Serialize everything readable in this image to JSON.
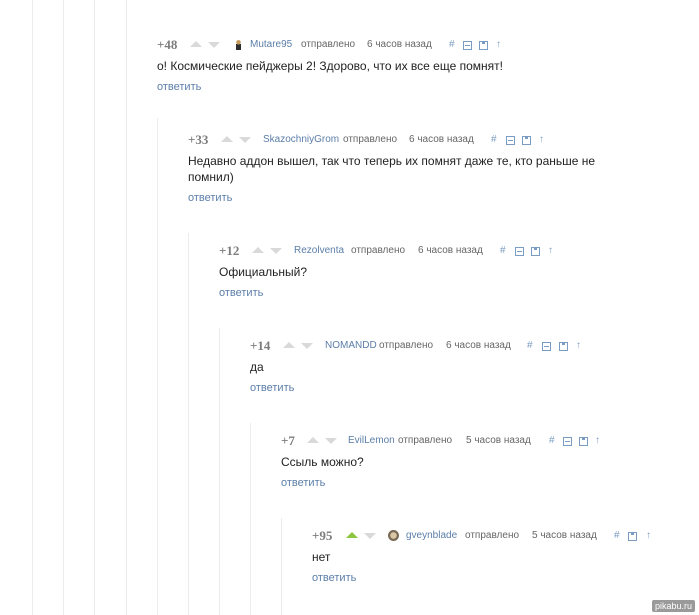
{
  "comments": [
    {
      "score": "+48",
      "user": "Mutare95",
      "sent": "отправлено",
      "time": "6 часов назад",
      "text": "о! Космические пейджеры 2! Здорово, что их все еще помнят!",
      "reply": "ответить"
    },
    {
      "score": "+33",
      "user": "SkazochniyGrom",
      "sent": "отправлено",
      "time": "6 часов назад",
      "text": "Недавно аддон вышел, так что теперь их помнят даже те, кто раньше не помнил)",
      "reply": "ответить"
    },
    {
      "score": "+12",
      "user": "Rezolventa",
      "sent": "отправлено",
      "time": "6 часов назад",
      "text": "Официальный?",
      "reply": "ответить"
    },
    {
      "score": "+14",
      "user": "NOMANDD",
      "sent": "отправлено",
      "time": "6 часов назад",
      "text": "да",
      "reply": "ответить"
    },
    {
      "score": "+7",
      "user": "EvilLemon",
      "sent": "отправлено",
      "time": "5 часов назад",
      "text": "Ссыль можно?",
      "reply": "ответить"
    },
    {
      "score": "+95",
      "user": "gveynblade",
      "sent": "отправлено",
      "time": "5 часов назад",
      "text": "нет",
      "reply": "ответить",
      "upvoted": true
    }
  ],
  "icons": {
    "hash": "#",
    "up": "↑"
  },
  "watermark": "pikabu.ru"
}
